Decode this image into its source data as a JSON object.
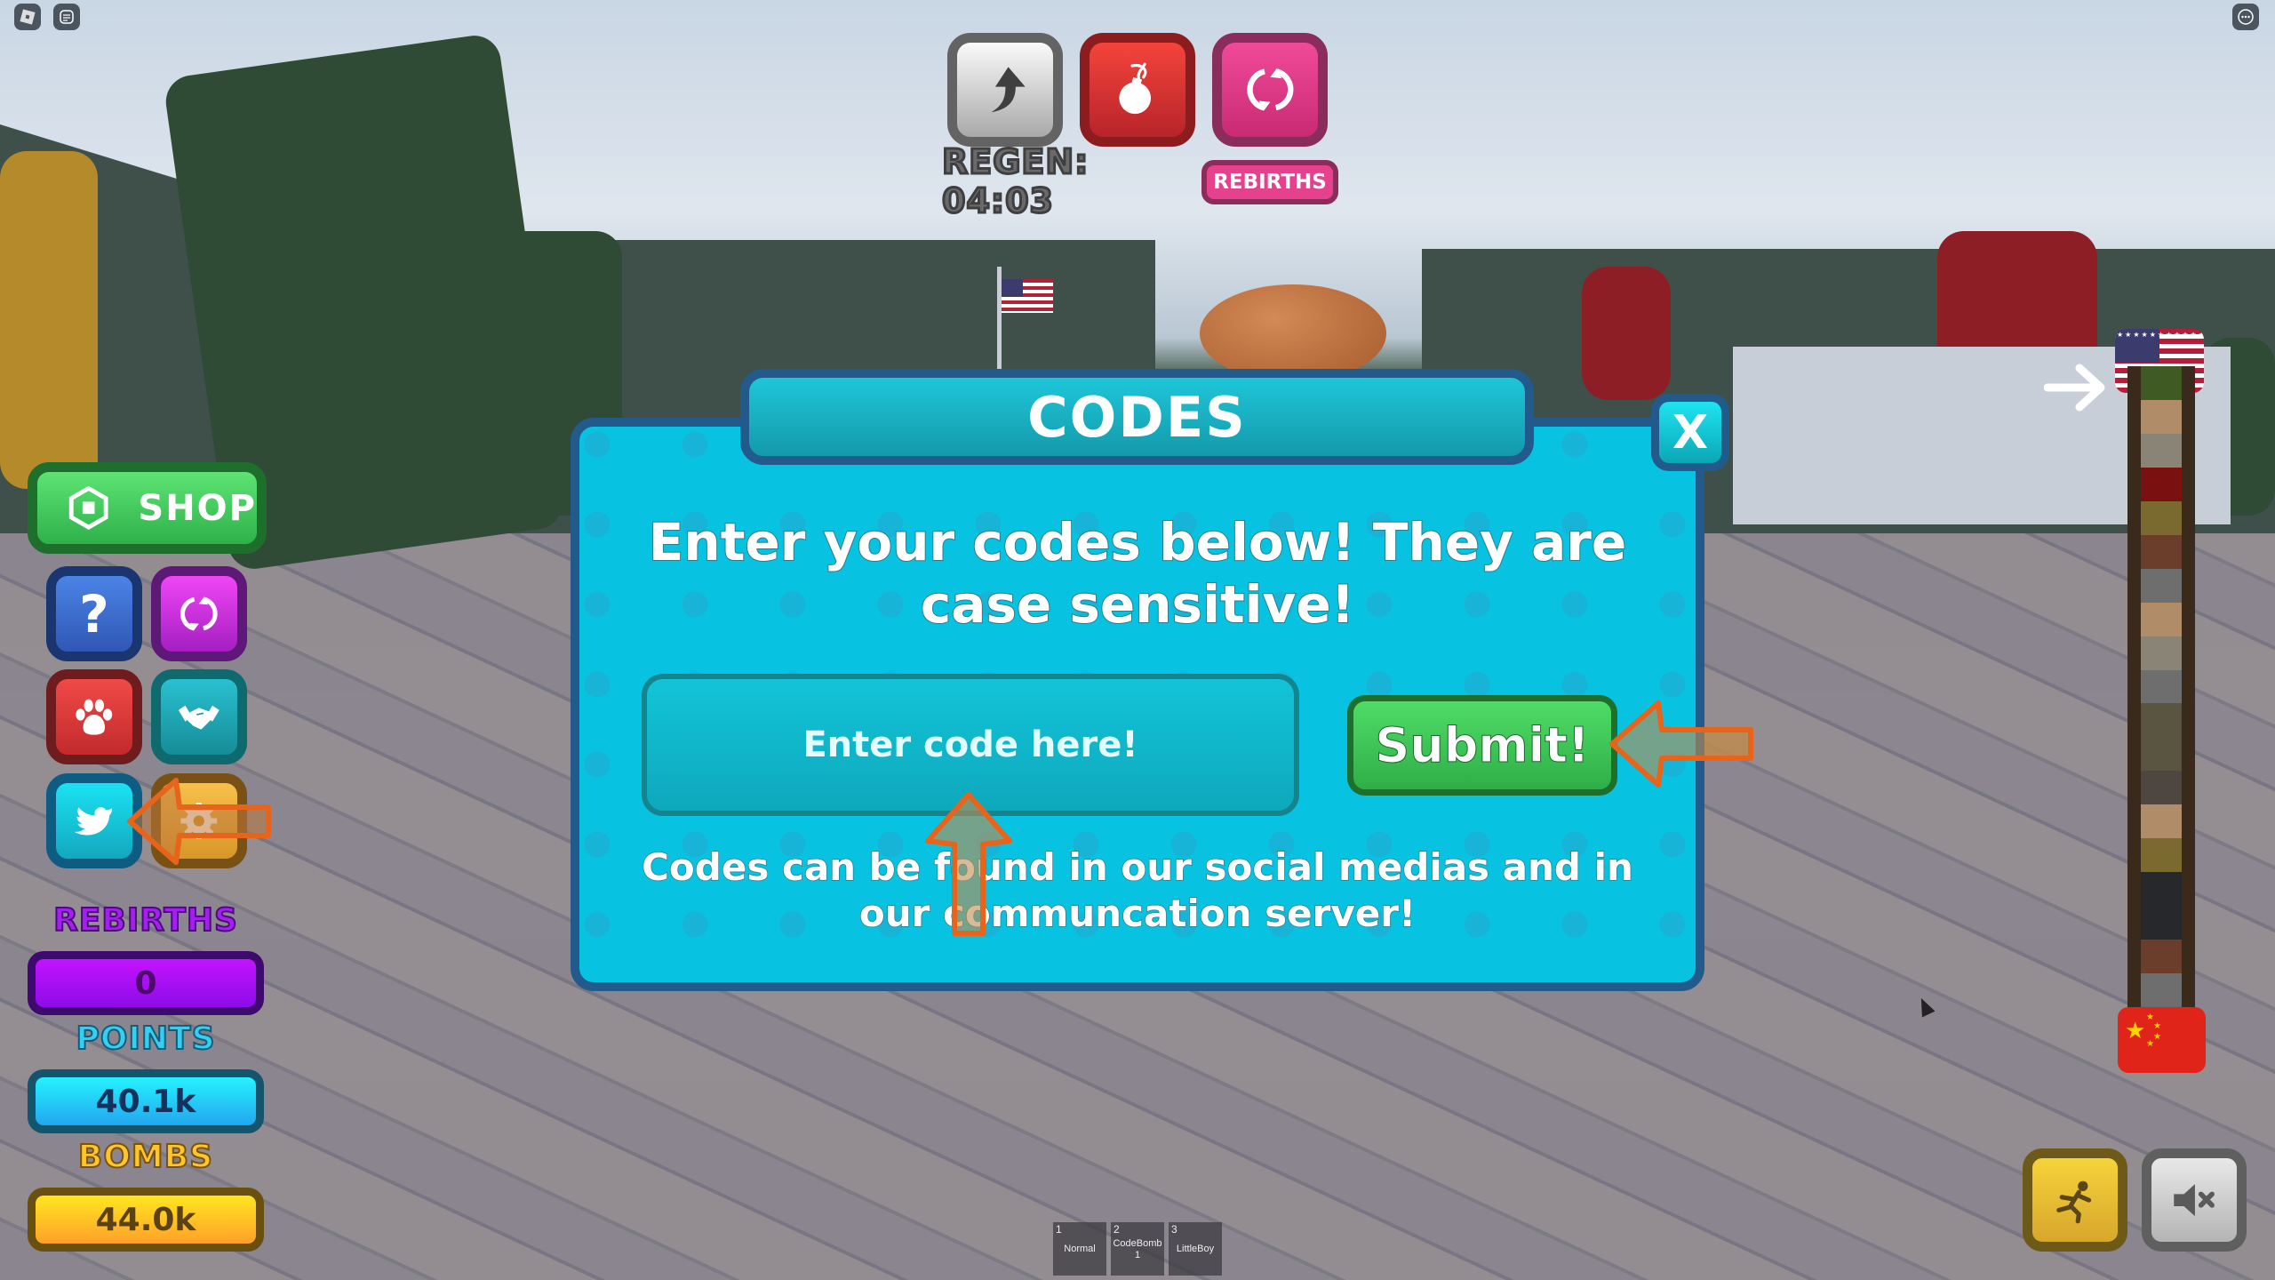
{
  "system_bar": {
    "left_icons": [
      "roblox-menu-icon",
      "chat-icon"
    ],
    "right_icons": [
      "more-options-icon"
    ]
  },
  "top_hud": {
    "buttons": [
      {
        "id": "upgrade",
        "icon": "upgrade-arrow-icon",
        "color": "#a9a9a9"
      },
      {
        "id": "bomb",
        "icon": "bomb-icon",
        "color": "#d0302f"
      },
      {
        "id": "rebirth",
        "icon": "rebirth-icon",
        "color": "#e6418d"
      }
    ],
    "regen_label": "REGEN: 04:03",
    "rebirths_button": "REBIRTHS"
  },
  "left_menu": {
    "shop_label": "SHOP",
    "buttons": [
      {
        "id": "help",
        "icon": "question-mark-icon",
        "glyph": "?"
      },
      {
        "id": "rebirth",
        "icon": "rebirth-icon"
      },
      {
        "id": "pets",
        "icon": "paw-icon"
      },
      {
        "id": "trade",
        "icon": "handshake-icon"
      },
      {
        "id": "twitter",
        "icon": "twitter-bird-icon"
      },
      {
        "id": "settings",
        "icon": "gear-icon"
      }
    ]
  },
  "stats": {
    "rebirths": {
      "label": "REBIRTHS",
      "value": "0"
    },
    "points": {
      "label": "POINTS",
      "value": "40.1k"
    },
    "bombs": {
      "label": "BOMBS",
      "value": "44.0k"
    }
  },
  "codes_dialog": {
    "title": "CODES",
    "close_label": "X",
    "instructions": "Enter your codes below! They are case sensitive!",
    "input_placeholder": "Enter code here!",
    "input_value": "",
    "submit_label": "Submit!",
    "footer": "Codes can be found in our social medias and in our communcation server!"
  },
  "progress_ladder": {
    "top_flag": "United States",
    "bottom_flag": "China",
    "arrow_icon": "arrow-right-icon",
    "layers": [
      "grass",
      "sand",
      "gravel",
      "lava",
      "moss",
      "dirt",
      "stone",
      "sand",
      "gravel",
      "stone",
      "mossy-rock",
      "mossy-rock",
      "rock",
      "sand",
      "moss",
      "basalt",
      "basalt",
      "dirt",
      "stone"
    ]
  },
  "bottom_right": {
    "run_icon": "running-person-icon",
    "mute_icon": "speaker-muted-icon"
  },
  "hotbar": [
    {
      "slot": "1",
      "name": "Normal"
    },
    {
      "slot": "2",
      "name": "CodeBomb 1"
    },
    {
      "slot": "3",
      "name": "LittleBoy"
    }
  ]
}
